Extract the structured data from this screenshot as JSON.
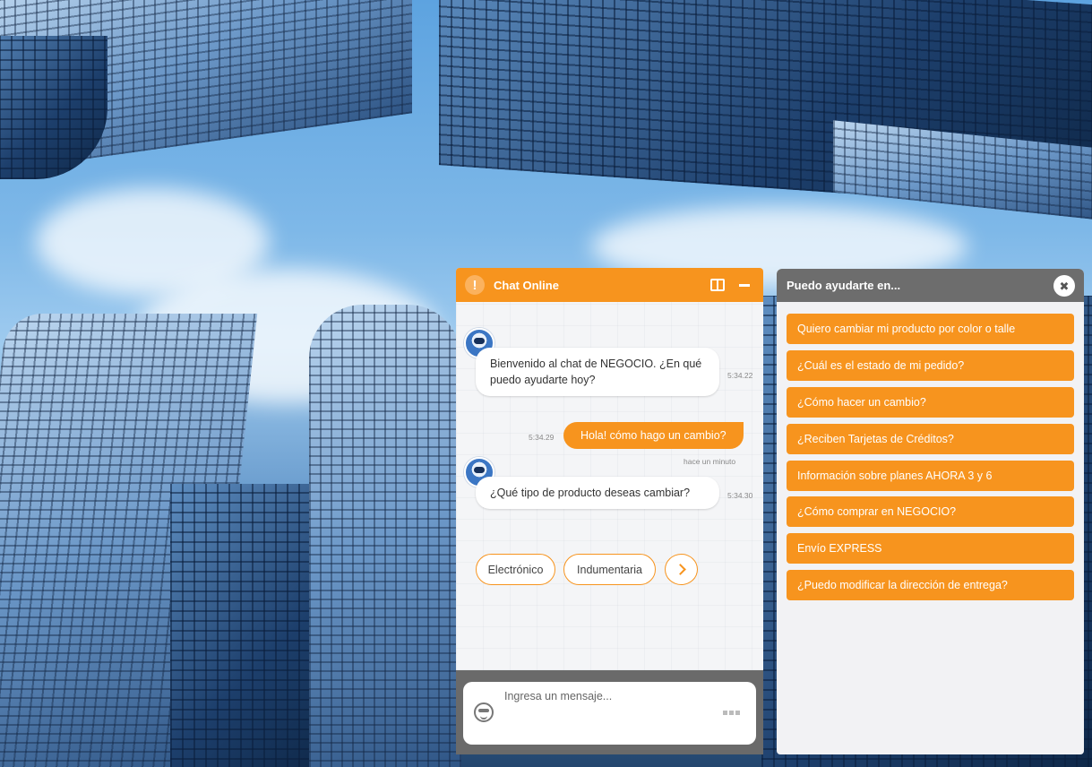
{
  "chat": {
    "title": "Chat Online",
    "messages": [
      {
        "from": "bot",
        "text": "Bienvenido al chat de NEGOCIO. ¿En qué puedo ayudarte hoy?",
        "time": "5:34.22"
      },
      {
        "from": "user",
        "text": "Hola! cómo hago un cambio?",
        "time": "5:34.29",
        "status": "hace un minuto"
      },
      {
        "from": "bot",
        "text": "¿Qué tipo de producto deseas cambiar?",
        "time": "5:34.30"
      }
    ],
    "choices": [
      "Electrónico",
      "Indumentaria"
    ],
    "input_placeholder": "Ingresa un mensaje..."
  },
  "help": {
    "title": "Puedo ayudarte en...",
    "items": [
      "Quiero cambiar mi producto por color o talle",
      "¿Cuál es el estado de mi pedido?",
      "¿Cómo hacer un cambio?",
      "¿Reciben Tarjetas de Créditos?",
      "Información sobre planes AHORA 3 y 6",
      "¿Cómo comprar en NEGOCIO?",
      "Envío EXPRESS",
      "¿Puedo modificar la dirección de entrega?"
    ]
  },
  "icons": {
    "alert": "alert-icon",
    "split": "split-view-icon",
    "minimize": "minimize-icon",
    "close": "close-icon",
    "emoji": "emoji-icon",
    "next": "chevron-right-icon"
  },
  "colors": {
    "accent": "#f7941e",
    "panel_header": "#6d6d6d",
    "footer": "#6a6a6a"
  }
}
